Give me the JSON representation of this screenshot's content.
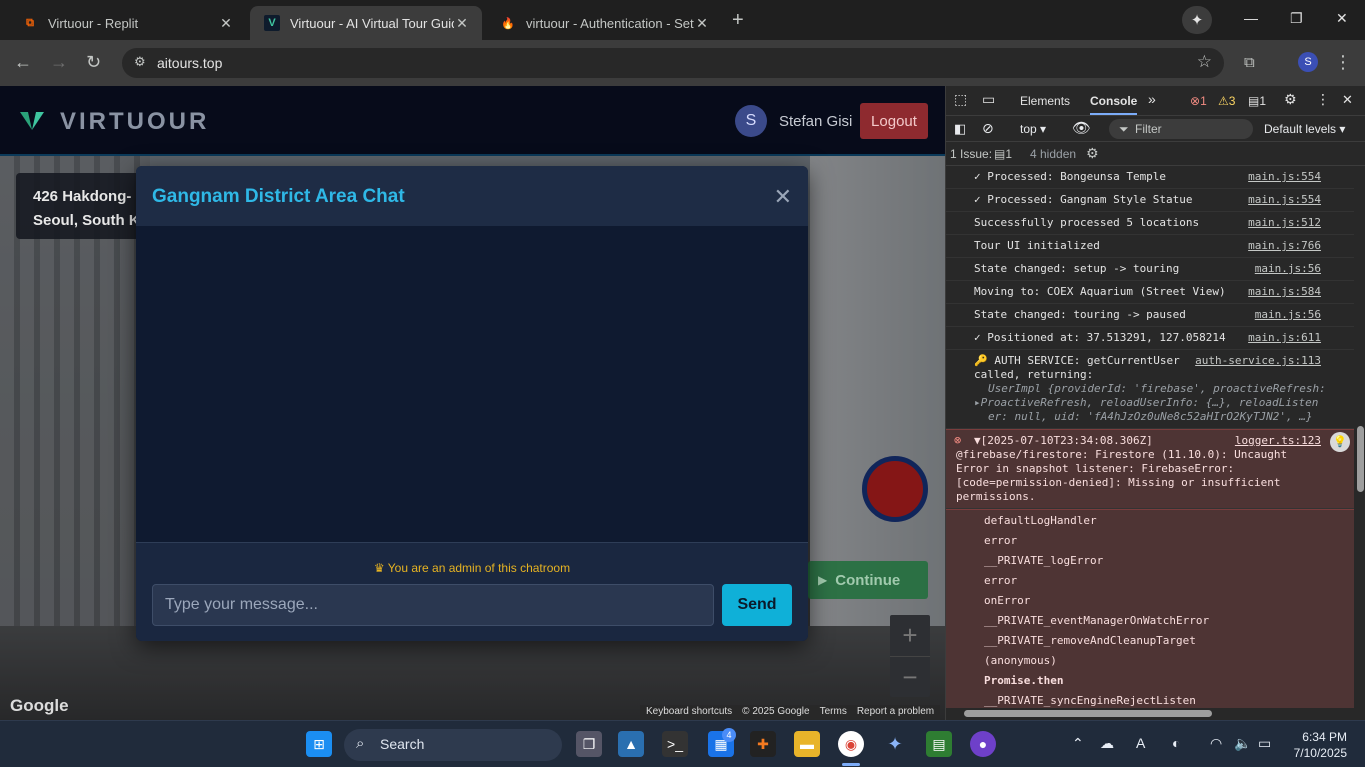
{
  "browser": {
    "tabs": [
      {
        "title": "Virtuour - Replit"
      },
      {
        "title": "Virtuour - AI Virtual Tour Guide"
      },
      {
        "title": "virtuour - Authentication - Setti"
      }
    ],
    "url": "aitours.top",
    "profile_initial": "S"
  },
  "app": {
    "brand": "VIRTUOUR",
    "user_initial": "S",
    "user_name": "Stefan Gisi",
    "logout_label": "Logout",
    "address_line1": "426 Hakdong-",
    "address_line2": "Seoul, South K",
    "continue_label": "Continue",
    "zoom_in": "+",
    "zoom_out": "−",
    "google_logo": "Google",
    "map_footer": [
      "Keyboard shortcuts",
      "© 2025 Google",
      "Terms",
      "Report a problem"
    ]
  },
  "chat": {
    "title": "Gangnam District Area Chat",
    "admin_note": "You are an admin of this chatroom",
    "input_placeholder": "Type your message...",
    "send_label": "Send"
  },
  "devtools": {
    "tabs": {
      "elements": "Elements",
      "console": "Console"
    },
    "error_count": "1",
    "warning_count": "3",
    "info_count": "1",
    "context": "top",
    "filter_placeholder": "Filter",
    "levels": "Default levels",
    "issues_label": "1 Issue:",
    "issues_count": "1",
    "hidden": "4 hidden",
    "logs": [
      {
        "msg": "✓ Processed: Bongeunsa Temple",
        "src": "main.js:554"
      },
      {
        "msg": "✓ Processed: Gangnam Style Statue",
        "src": "main.js:554"
      },
      {
        "msg": "Successfully processed 5 locations",
        "src": "main.js:512"
      },
      {
        "msg": "Tour UI initialized",
        "src": "main.js:766"
      },
      {
        "msg": "State changed: setup -> touring",
        "src": "main.js:56"
      },
      {
        "msg": "Moving to: COEX Aquarium (Street View)",
        "src": "main.js:584"
      },
      {
        "msg": "State changed: touring -> paused",
        "src": "main.js:56"
      },
      {
        "msg": "✓ Positioned at: 37.513291, 127.058214",
        "src": "main.js:611"
      }
    ],
    "auth_log": {
      "msg1": "🔑 AUTH SERVICE: getCurrentUser",
      "msg2": "called, returning:",
      "src": "auth-service.js:113",
      "obj1": "UserImpl {providerId: 'firebase', proactiveRefresh:",
      "obj2": "▸ProactiveRefresh, reloadUserInfo: {…}, reloadListen",
      "obj3": "er: null, uid: 'fA4hJzOz0uNe8c52aHIrO2KyTJN2', …}"
    },
    "error_log": {
      "head": "▼[2025-07-10T23:34:08.306Z]",
      "src": "logger.ts:123",
      "body": "@firebase/firestore: Firestore (11.10.0): Uncaught Error in snapshot listener: FirebaseError: [code=permission-denied]: Missing or insufficient permissions.",
      "stack": [
        "defaultLogHandler",
        "error",
        "__PRIVATE_logError",
        "error",
        "onError",
        "__PRIVATE_eventManagerOnWatchError",
        "__PRIVATE_removeAndCleanupTarget",
        "(anonymous)",
        "Promise.then",
        "__PRIVATE_syncEngineRejectListen"
      ]
    }
  },
  "taskbar": {
    "search_label": "Search",
    "badge": "4",
    "time": "6:34 PM",
    "date": "7/10/2025"
  }
}
